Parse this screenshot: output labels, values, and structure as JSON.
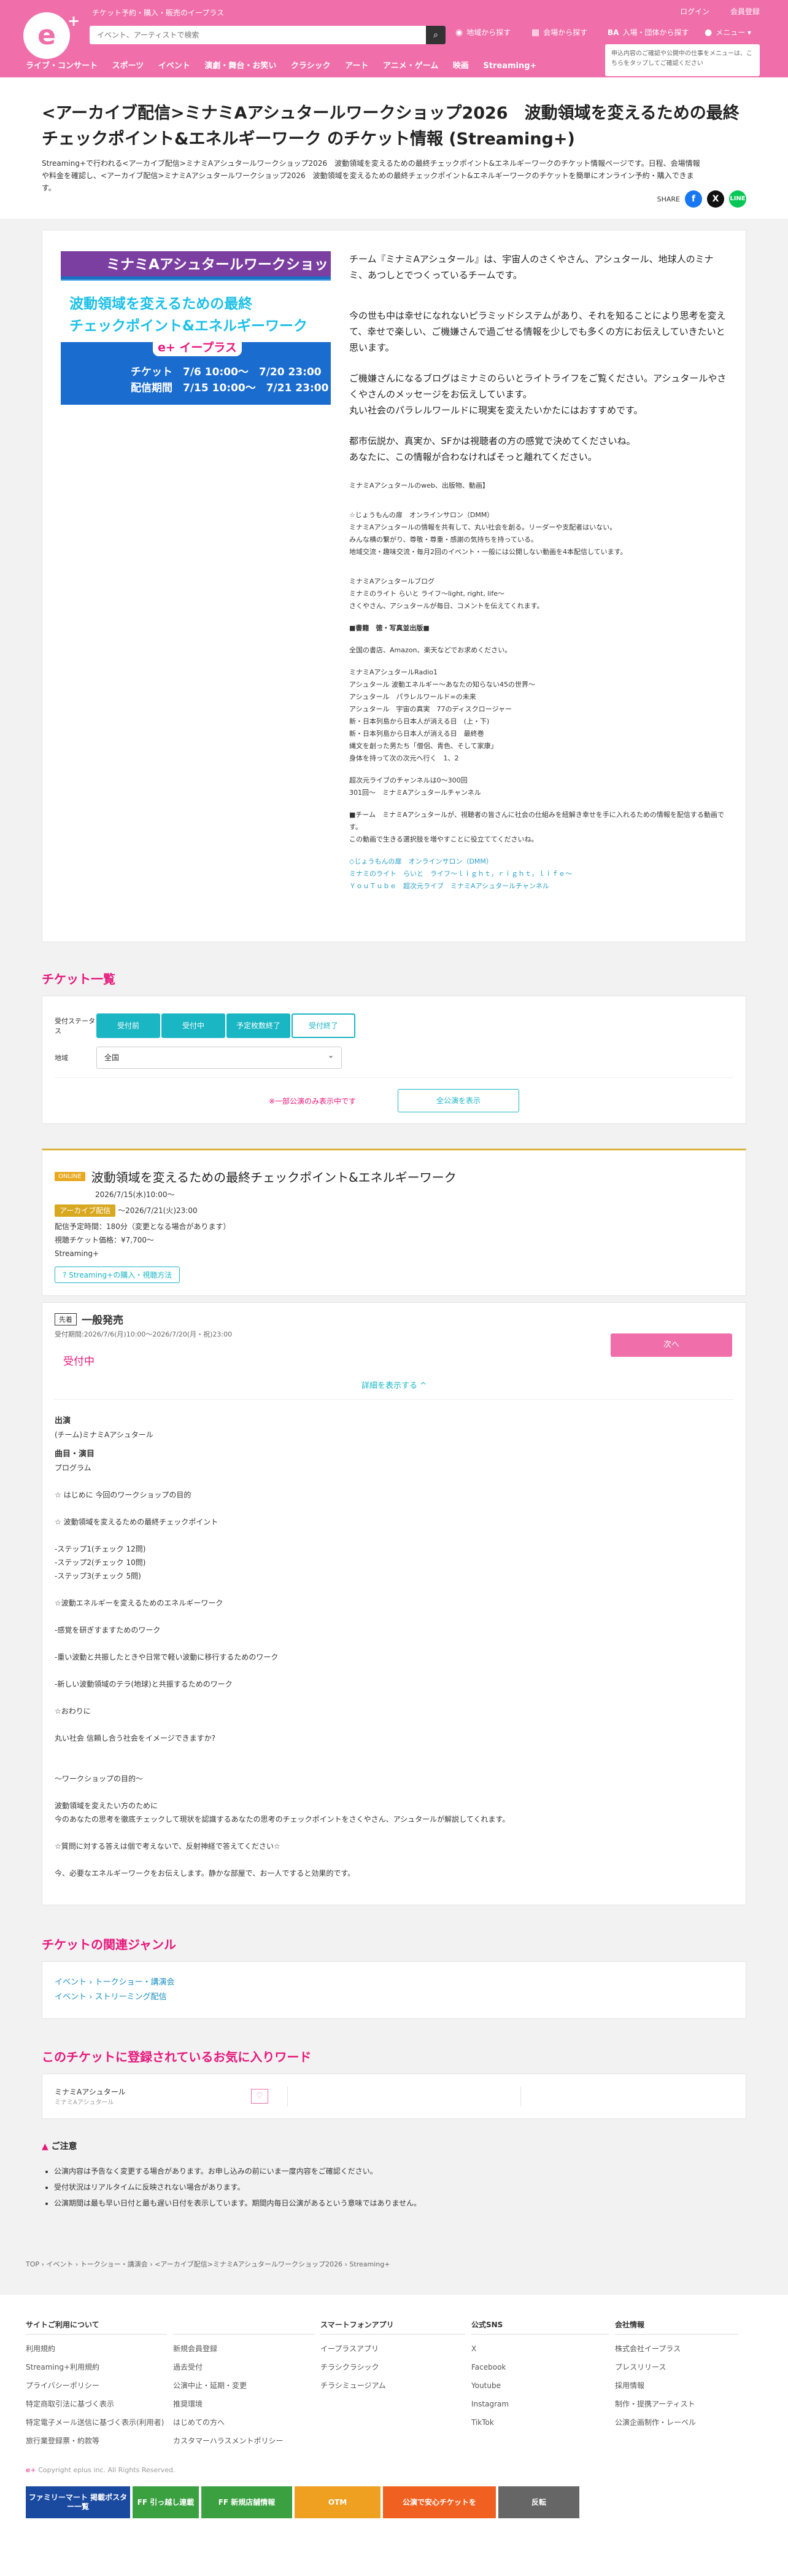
{
  "header": {
    "logo_text": "イープラス",
    "tagline": "チケット予約・購入・販売のイープラス",
    "search_placeholder": "イベント、アーティストで検索",
    "login": "ログイン",
    "register": "会員登録",
    "nav_region": "地域から探す",
    "nav_venue": "会場から探す",
    "nav_ba": "入場・団体から探す",
    "nav_menu": "メニュー",
    "genres": [
      "ライブ・コンサート",
      "スポーツ",
      "イベント",
      "演劇・舞台・お笑い",
      "クラシック",
      "アート",
      "アニメ・ゲーム",
      "映画",
      "Streaming+"
    ],
    "notice": "申込内容のご確認や公開中の仕事をメニューは、こちらをタップしてご確認ください"
  },
  "page": {
    "title": "<アーカイブ配信>ミナミAアシュタールワークショップ2026　波動領域を変えるための最終チェックポイント&エネルギーワーク のチケット情報 (Streaming+)",
    "intro": "Streaming+で行われる<アーカイブ配信>ミナミAアシュタールワークショップ2026　波動領域を変えるための最終チェックポイント&エネルギーワークのチケット情報ページです。日程、会場情報や料金を確認し、<アーカイブ配信>ミナミAアシュタールワークショップ2026　波動領域を変えるための最終チェックポイント&エネルギーワークのチケットを簡単にオンライン予約・購入できます。",
    "share": "SHARE"
  },
  "banner": {
    "top": "ミナミAアシュタールワークショップ",
    "mid1": "波動領域を変えるための最終",
    "mid2": "チェックポイント&エネルギーワーク",
    "logo": "e+ イープラス",
    "ticket": "チケット　7/6 10:00〜　7/20 23:00",
    "stream": "配信期間　7/15 10:00〜　7/21 23:00"
  },
  "about": {
    "p1": "チーム『ミナミAアシュタール』は、宇宙人のさくやさん、アシュタール、地球人のミナミ、あつしとでつくっているチームです。",
    "p2": "今の世も中は幸せになれないピラミッドシステムがあり、それを知ることにより思考を変えて、幸せで楽しい、ご機嫌さんで過ごせる情報を少しでも多くの方にお伝えしていきたいと思います。",
    "p3": "ご機嫌さんになるブログはミナミのらいとライトライフをご覧ください。アシュタールやさくやさんのメッセージをお伝えしています。\n丸い社会のパラレルワールドに現実を変えたいかたにはおすすめです。",
    "p4": "都市伝説か、真実か、SFかは視聴者の方の感覚で決めてくださいね。\nあなたに、この情報が合わなければそっと離れてください。",
    "s1": "ミナミAアシュタールのweb、出版物、動画】",
    "s2": "☆じょうもんの扉　オンラインサロン（DMM）\nミナミAアシュタールの情報を共有して、丸い社会を創る。リーダーや支配者はいない。\nみんな横の繋がり、尊敬・尊重・感謝の気持ちを持っている。\n地域交流・趣味交流・毎月2回のイベント・一般には公開しない動画を4本配信しています。",
    "s3": "ミナミAアシュタールブログ\nミナミのライト らいと ライフ〜light, right, life〜\nさくやさん、アシュタールが毎日、コメントを伝えてくれます。",
    "s4": "■書籍　徳・写真並出版■",
    "s5": "全国の書店、Amazon、楽天などでお求めください。",
    "s6": "ミナミAアシュタールRadio1\nアシュタール 波動エネルギー〜あなたの知らない45の世界〜\nアシュタール　パラレルワールド∞の未来\nアシュタール　宇宙の真実　77のディスクロージャー\n新・日本列島から日本人が消える日　(上・下)\n新・日本列島から日本人が消える日　最終巻\n縄文を創った男たち「僧侶、青色、そして家康」\n身体を持って次の次元へ行く　1、2",
    "s7": "超次元ライブのチャンネルは0〜300回\n301回〜　ミナミAアシュタールチャンネル",
    "s8": "■チーム　ミナミAアシュタールが、視聴者の皆さんに社会の仕組みを紐解き幸せを手に入れるための情報を配信する動画です。\nこの動画で生きる選択肢を増やすことに役立ててくださいね。",
    "l1": "◇じょうもんの扉　オンラインサロン（DMM）",
    "l2": "ミナミのライト　らいと　ライフ〜ｌｉｇｈｔ，ｒｉｇｈｔ，ｌｉｆｅ〜",
    "l3": "ＹｏｕＴｕｂｅ　超次元ライブ　ミナミAアシュタールチャンネル"
  },
  "tickets": {
    "heading": "チケット一覧",
    "status_label": "受付ステータス",
    "chips": [
      "受付前",
      "受付中",
      "予定枚数終了",
      "受付終了"
    ],
    "region_label": "地域",
    "region_value": "全国",
    "warning": "※一部公演のみ表示中です",
    "show_all": "全公演を表示"
  },
  "performance": {
    "online": "ONLINE",
    "title": "波動領域を変えるための最終チェックポイント&エネルギーワーク",
    "date": "2026/7/15(水)10:00〜",
    "archive_tag": "アーカイブ配信",
    "archive_end": "〜2026/7/21(火)23:00",
    "m1": "配信予定時間：180分（変更となる場合があります）",
    "m2": "視聴チケット価格：¥7,700〜",
    "m3": "Streaming+",
    "how": "Streaming+の購入・視聴方法"
  },
  "sale": {
    "label": "先着",
    "title": "一般発売",
    "period": "受付期間:2026/7/6(月)10:00〜2026/7/20(月・祝)23:00",
    "next": "次へ",
    "status": "受付中",
    "detail": "詳細を表示する ^",
    "cast_h": "出演",
    "cast": "(チーム)ミナミAアシュタール",
    "prog_h": "曲目・演目",
    "program": "プログラム\n\n☆ はじめに 今回のワークショップの目的\n\n☆ 波動領域を変えるための最終チェックポイント\n\n-ステップ1(チェック 12問)\n-ステップ2(チェック 10問)\n-ステップ3(チェック 5問)\n\n☆波動エネルギーを変えるためのエネルギーワーク\n\n-感覚を研ぎすますためのワーク\n\n-重い波動と共振したときや日常で軽い波動に移行するためのワーク\n\n-新しい波動領域のテラ(地球)と共振するためのワーク\n\n☆おわりに\n\n丸い社会 信頼し合う社会をイメージできますか?\n\n\n〜ワークショップの目的〜\n\n波動領域を変えたい方のために\n今のあなたの思考を徹底チェックして現状を認識するあなたの思考のチェックポイントをさくやさん、アシュタールが解説してくれます。\n\n☆質問に対する答えは個で考えないで、反射神経で答えてください☆\n\n今、必要なエネルギーワークをお伝えします。静かな部屋で、お一人ですると効果的です。"
  },
  "genre": {
    "heading": "チケットの関連ジャンル",
    "rows": [
      [
        "イベント",
        "トークショー・講演会"
      ],
      [
        "イベント",
        "ストリーミング配信"
      ]
    ]
  },
  "fav": {
    "heading": "このチケットに登録されているお気に入りワード",
    "name": "ミナミAアシュタール",
    "sub": "ミナミAアシュタール"
  },
  "caution": {
    "heading": "ご注意",
    "items": [
      "公演内容は予告なく変更する場合があります。お申し込みの前にいま一度内容をご確認ください。",
      "受付状況はリアルタイムに反映されない場合があります。",
      "公演期間は最も早い日付と最も遅い日付を表示しています。期間内毎日公演があるという意味ではありません。"
    ]
  },
  "breadcrumb": "TOP  ›  イベント  ›  トークショー・講演会  ›  <アーカイブ配信>ミナミAアシュタールワークショップ2026  ›  Streaming+",
  "footer": {
    "cols": [
      {
        "h": "サイトご利用について",
        "items": [
          "利用規約",
          "Streaming+利用規約",
          "プライバシーポリシー",
          "特定商取引法に基づく表示",
          "特定電子メール送信に基づく表示(利用者)",
          "旅行業登録票・約款等"
        ]
      },
      {
        "h": "",
        "items": [
          "新規会員登録",
          "過去受付",
          "公演中止・延期・変更",
          "推奨環境",
          "はじめての方へ",
          "カスタマーハラスメントポリシー"
        ]
      },
      {
        "h": "スマートフォンアプリ",
        "items": [
          "イープラスアプリ",
          "チラシクラシック",
          "チラシミュージアム"
        ]
      },
      {
        "h": "公式SNS",
        "items": [
          "X",
          "Facebook",
          "Youtube",
          "Instagram",
          "TikTok"
        ]
      },
      {
        "h": "会社情報",
        "items": [
          "株式会社イープラス",
          "プレスリリース",
          "採用情報",
          "制作・提携アーティスト",
          "公演企画制作・レーベル"
        ]
      }
    ],
    "copyright": "Copyright eplus inc. All Rights Reserved.",
    "banners": [
      "ファミリーマート 掲載ポスター一覧",
      "FF 引っ越し連載",
      "FF 新規店舗情報",
      "OTM",
      "公演で安心チケットを",
      "反転"
    ]
  }
}
